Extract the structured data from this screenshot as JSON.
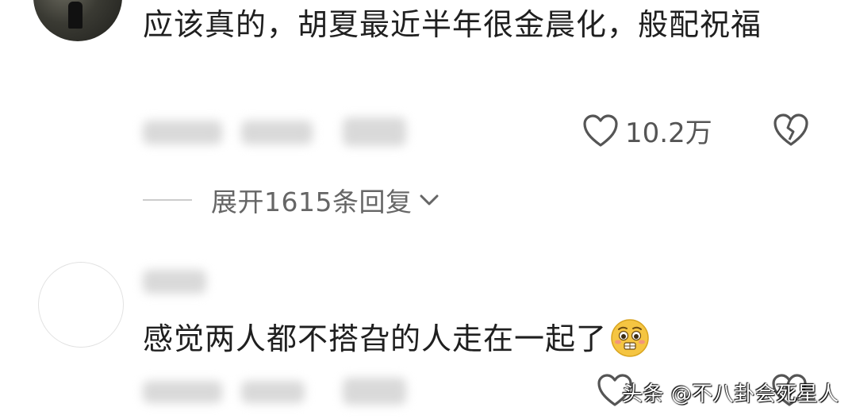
{
  "comments": [
    {
      "text": "应该真的，胡夏最近半年很金晨化，般配祝福",
      "like_count": "10.2万",
      "expand_label": "展开1615条回复"
    },
    {
      "text": "感觉两人都不搭旮的人走在一起了"
    }
  ],
  "icons": {
    "like": "heart-outline-icon",
    "dislike": "broken-heart-icon",
    "expand": "chevron-down-icon",
    "emoji": "worried-face-emoji"
  },
  "watermark": "头条 @不八卦会死星人",
  "colors": {
    "text": "#1f1f1f",
    "muted": "#666666",
    "icon": "#555555",
    "emoji": "#f5c542"
  }
}
